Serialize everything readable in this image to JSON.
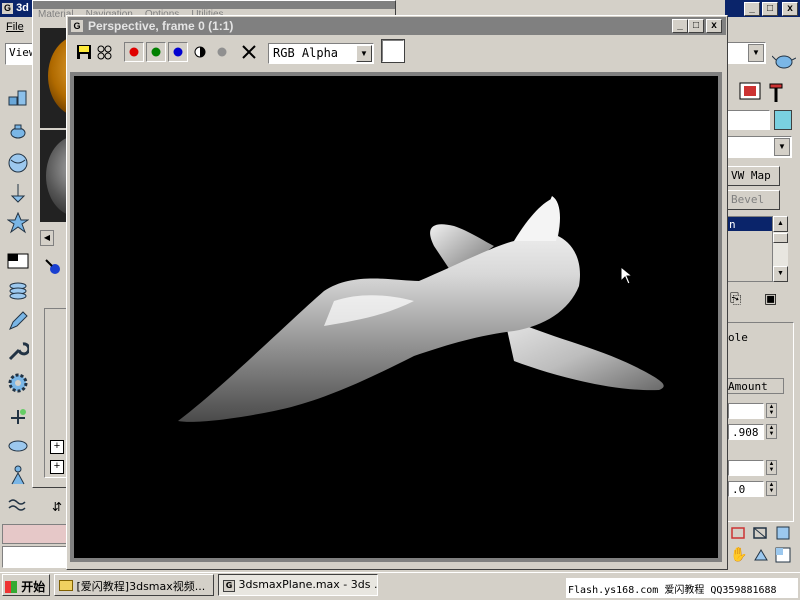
{
  "main_window": {
    "title_fragment": "3d",
    "menu_file": "File",
    "view_dropdown": "View",
    "title_buttons": [
      "_",
      "□",
      "x"
    ]
  },
  "material_editor": {
    "menu": [
      "Material",
      "Navigation",
      "Options",
      "Utilities"
    ]
  },
  "render_window": {
    "title": "Perspective, frame 0 (1:1)",
    "channel_dropdown": "RGB Alpha",
    "toolbar_icons": [
      "save-icon",
      "clone-icon",
      "red-channel-icon",
      "green-channel-icon",
      "blue-channel-icon",
      "mono-icon",
      "gray-dot-icon",
      "clear-icon"
    ],
    "title_buttons": [
      "_",
      "□",
      "x"
    ],
    "swatch_color": "#ffffff"
  },
  "right_panel": {
    "uvw_map_button": "VW Map",
    "bevel_button": "Bevel",
    "list_item": "n",
    "hole_label": "ole",
    "amount_label": "Amount",
    "amount_value": ".908",
    "value_field": ".0"
  },
  "taskbar": {
    "start_label": "开始",
    "task1": "[爱闪教程]3dsmax视频...",
    "task2": "3dsmaxPlane.max - 3ds ...",
    "tray_text": "Flash.ys168.com 爱闪教程 QQ359881688"
  },
  "colors": {
    "title_active": "#0a246a",
    "title_inactive": "#808080",
    "window_face": "#d4d0c8",
    "viewport": "#000000",
    "swatch_cyan": "#7ad0e0",
    "taskbar": "#d4d0c8"
  }
}
